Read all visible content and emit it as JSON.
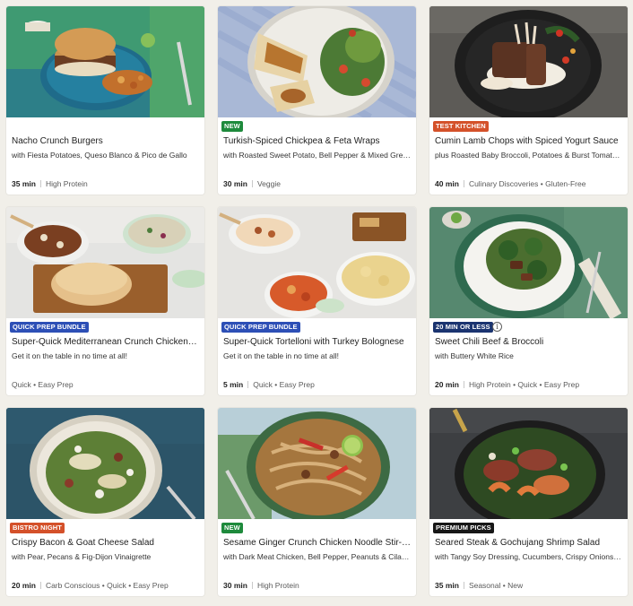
{
  "colors": {
    "badge_green": "#1e8a3c",
    "badge_red": "#d4512a",
    "badge_blue": "#2d4fb6",
    "badge_navy": "#1b3470",
    "badge_black": "#171717",
    "page_bg": "#f1efe9"
  },
  "recipes": [
    {
      "title": "Nacho Crunch Burgers",
      "subtitle": "with Fiesta Potatoes, Queso Blanco & Pico de Gallo",
      "time": "35 min",
      "tags": "High Protein",
      "badge": "",
      "image": "burger-plate"
    },
    {
      "title": "Turkish-Spiced Chickpea & Feta Wraps",
      "subtitle": "with Roasted Sweet Potato, Bell Pepper & Mixed Greens",
      "time": "30 min",
      "tags": "Veggie",
      "badge": "NEW",
      "badge_color": "#1e8a3c",
      "image": "wrap-plate"
    },
    {
      "title": "Cumin Lamb Chops with Spiced Yogurt Sauce",
      "subtitle": "plus Roasted Baby Broccoli, Potatoes & Burst Tomatoes",
      "time": "40 min",
      "tags": "Culinary Discoveries • Gluten-Free",
      "badge": "TEST KITCHEN",
      "badge_color": "#d4512a",
      "image": "lamb-plate"
    },
    {
      "title": "Super-Quick Mediterranean Crunch Chicken Bowls",
      "subtitle": "Get it on the table in no time at all!",
      "time": "",
      "tags": "Quick • Easy Prep",
      "badge": "QUICK PREP BUNDLE",
      "badge_color": "#2d4fb6",
      "image": "bundle-pita"
    },
    {
      "title": "Super-Quick Tortelloni with Turkey Bolognese",
      "subtitle": "Get it on the table in no time at all!",
      "time": "5 min",
      "tags": "Quick • Easy Prep",
      "badge": "QUICK PREP BUNDLE",
      "badge_color": "#2d4fb6",
      "image": "bundle-pasta"
    },
    {
      "title": "Sweet Chili Beef & Broccoli",
      "subtitle": "with Buttery White Rice",
      "time": "20 min",
      "tags": "High Protein • Quick • Easy Prep",
      "badge": "20 MIN OR LESS",
      "badge_color": "#1b3470",
      "info": "i",
      "image": "beef-bowl"
    },
    {
      "title": "Crispy Bacon & Goat Cheese Salad",
      "subtitle": "with Pear, Pecans & Fig-Dijon Vinaigrette",
      "time": "20 min",
      "tags": "Carb Conscious • Quick • Easy Prep",
      "badge": "BISTRO NIGHT",
      "badge_color": "#d4512a",
      "image": "salad-bowl"
    },
    {
      "title": "Sesame Ginger Crunch Chicken Noodle Stir-Fry",
      "subtitle": "with Dark Meat Chicken, Bell Pepper, Peanuts & Cilantro",
      "time": "30 min",
      "tags": "High Protein",
      "badge": "NEW",
      "badge_color": "#1e8a3c",
      "image": "noodle-bowl"
    },
    {
      "title": "Seared Steak & Gochujang Shrimp Salad",
      "subtitle": "with Tangy Soy Dressing, Cucumbers, Crispy Onions & More",
      "time": "35 min",
      "tags": "Seasonal • New",
      "badge": "PREMIUM PICKS",
      "badge_color": "#171717",
      "image": "steak-shrimp"
    }
  ]
}
